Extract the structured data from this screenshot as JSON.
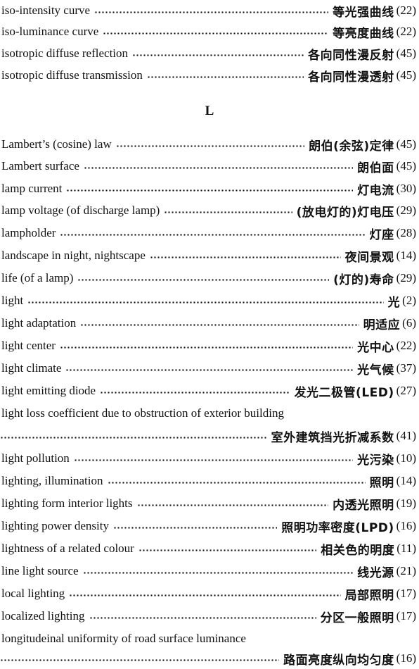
{
  "section_heading": "L",
  "entries": [
    {
      "en": "iso-intensity curve",
      "zh": "等光强曲线",
      "page": "(22)"
    },
    {
      "en": "iso-luminance curve",
      "zh": "等亮度曲线",
      "page": "(22)"
    },
    {
      "en": "isotropic diffuse reflection",
      "zh": "各向同性漫反射",
      "page": "(45)"
    },
    {
      "en": "isotropic diffuse transmission",
      "zh": "各向同性漫透射",
      "page": "(45)"
    },
    {
      "en": "Lambert’s (cosine) law",
      "zh": "朗伯(余弦)定律",
      "page": "(45)"
    },
    {
      "en": "Lambert surface",
      "zh": "朗伯面",
      "page": "(45)"
    },
    {
      "en": "lamp current",
      "zh": "灯电流",
      "page": "(30)"
    },
    {
      "en": "lamp voltage (of discharge lamp)",
      "zh": "(放电灯的)灯电压",
      "page": "(29)"
    },
    {
      "en": "lampholder",
      "zh": "灯座",
      "page": "(28)"
    },
    {
      "en": "landscape in night, nightscape",
      "zh": "夜间景观",
      "page": "(14)"
    },
    {
      "en": "life (of a lamp)",
      "zh": "(灯的)寿命",
      "page": "(29)"
    },
    {
      "en": "light",
      "zh": "光",
      "page": "(2)"
    },
    {
      "en": "light adaptation",
      "zh": "明适应",
      "page": "(6)"
    },
    {
      "en": "light center",
      "zh": "光中心",
      "page": "(22)"
    },
    {
      "en": "light climate",
      "zh": "光气候",
      "page": "(37)"
    },
    {
      "en": "light emitting diode",
      "zh": "发光二极管(LED)",
      "page": "(27)"
    },
    {
      "en": "light loss coefficient due to obstruction of exterior building",
      "zh": "室外建筑挡光折减系数",
      "page": "(41)"
    },
    {
      "en": "light pollution",
      "zh": "光污染",
      "page": "(10)"
    },
    {
      "en": "lighting, illumination",
      "zh": "照明",
      "page": "(14)"
    },
    {
      "en": "lighting form interior lights",
      "zh": "内透光照明",
      "page": "(19)"
    },
    {
      "en": "lighting power density",
      "zh": "照明功率密度(LPD)",
      "page": "(16)"
    },
    {
      "en": "lightness of a related colour",
      "zh": "相关色的明度",
      "page": "(11)"
    },
    {
      "en": "line light source",
      "zh": "线光源",
      "page": "(21)"
    },
    {
      "en": "local lighting",
      "zh": "局部照明",
      "page": "(17)"
    },
    {
      "en": "localized lighting",
      "zh": "分区一般照明",
      "page": "(17)"
    },
    {
      "en": "longitudeinal uniformity of road surface luminance",
      "zh": "路面亮度纵向均匀度",
      "page": "(16)"
    }
  ]
}
